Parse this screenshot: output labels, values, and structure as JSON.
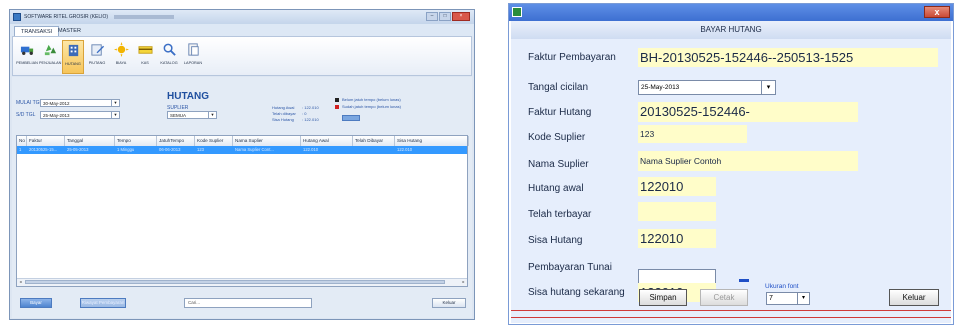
{
  "left_app": {
    "title": "SOFTWARE RITEL GROSIR (KELIO)",
    "tabs": [
      {
        "label": "TRANSAKSI"
      },
      {
        "label": "MASTER"
      }
    ],
    "ribbon": [
      {
        "label": "PEMBELIAN",
        "icon": "truck-icon"
      },
      {
        "label": "PENJUALAN",
        "icon": "recycle-icon"
      },
      {
        "label": "HUTANG",
        "icon": "building-icon"
      },
      {
        "label": "PIUTANG",
        "icon": "edit-icon"
      },
      {
        "label": "BIAYA",
        "icon": "sun-icon"
      },
      {
        "label": "KAS",
        "icon": "card-icon"
      },
      {
        "label": "KATALOG",
        "icon": "magnifier-icon"
      },
      {
        "label": "LAPORAN",
        "icon": "document-icon"
      }
    ],
    "filter": {
      "mulai_label": "MULAI TGL",
      "mulai_value": "30-May-2012",
      "sd_label": "S/D TGL",
      "sd_value": "25-May-2013",
      "suplier_label": "SUPLIER",
      "suplier_value": "SEMUA"
    },
    "page_title": "HUTANG",
    "summary": {
      "hutang_awal_label": "Hutang Awal",
      "hutang_awal_value": ": 122.010",
      "telah_dibayar_label": "Telah dibayar",
      "telah_dibayar_value": ": 0",
      "sisa_hutang_label": "Sisa Hutang",
      "sisa_hutang_value": ": 122.010"
    },
    "legend": [
      {
        "label": "Belum jatuh tempo (belum lunas)",
        "color": "#222222"
      },
      {
        "label": "Sudah jatuh tempo (belum lunas)",
        "color": "#d02020"
      }
    ],
    "table": {
      "columns": [
        "No",
        "Faktur",
        "Tanggal",
        "Tempo",
        "JatuhTempo",
        "Kode Suplier",
        "Nama Suplier",
        "Hutang Awal",
        "Telah Dibayar",
        "Sisa Hutang"
      ],
      "rows": [
        [
          "1",
          "20130525-15...",
          "25-05-2013",
          "1 Minggu",
          "06-06-2013",
          "123",
          "Nama Suplier Cont...",
          "122.010",
          "",
          "122.010"
        ]
      ]
    },
    "bottom": {
      "bayar_label": "Bayar",
      "riwayat_label": "Riwayat Pembayaran",
      "cari_placeholder": "Cari...",
      "keluar_label": "Keluar"
    },
    "accent_color": "#3399ff"
  },
  "dialog": {
    "header": "BAYAR HUTANG",
    "fields": {
      "faktur_pembayaran_label": "Faktur Pembayaran",
      "faktur_pembayaran_value": "BH-20130525-152446--250513-1525",
      "tanggal_cicilan_label": "Tangal cicilan",
      "tanggal_cicilan_value": "25-May-2013",
      "faktur_hutang_label": "Faktur Hutang",
      "faktur_hutang_value": "20130525-152446-",
      "kode_suplier_label": "Kode Suplier",
      "kode_suplier_value": "123",
      "nama_suplier_label": "Nama Suplier",
      "nama_suplier_value": "Nama Suplier Contoh",
      "hutang_awal_label": "Hutang awal",
      "hutang_awal_value": "122010",
      "telah_terbayar_label": "Telah terbayar",
      "telah_terbayar_value": "",
      "sisa_hutang_label": "Sisa Hutang",
      "sisa_hutang_value": "122010",
      "pembayaran_tunai_label": "Pembayaran Tunai",
      "pembayaran_tunai_value": "",
      "sisa_sekarang_label": "Sisa hutang sekarang",
      "sisa_sekarang_value": "122010"
    },
    "buttons": {
      "simpan": "Simpan",
      "cetak": "Cetak",
      "keluar": "Keluar"
    },
    "font_size_label": "Ukuran font",
    "font_size_value": "7",
    "close_glyph": "x",
    "dash_glyph": "-",
    "field_bg_color": "#fffdc9",
    "line_color": "#d03a3a"
  }
}
